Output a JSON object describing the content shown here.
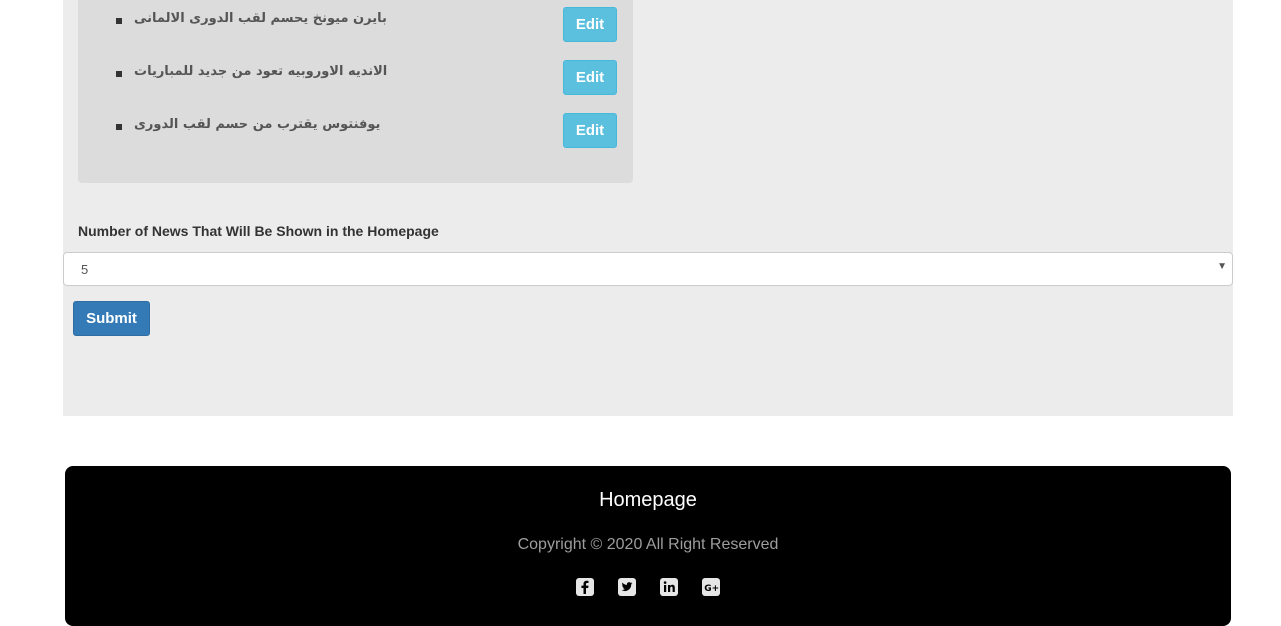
{
  "news": {
    "items": [
      {
        "title": "بايرن ميونخ يحسم لقب الدورى الالمانى",
        "edit_label": "Edit"
      },
      {
        "title": "الانديه الاوروبيه تعود من جديد للمباريات",
        "edit_label": "Edit"
      },
      {
        "title": "يوفنتوس يقترب من حسم لقب الدورى",
        "edit_label": "Edit"
      }
    ]
  },
  "settings": {
    "label": "Number of News That Will Be Shown in the Homepage",
    "selected_value": "5",
    "submit_label": "Submit"
  },
  "footer": {
    "title": "Homepage",
    "copyright": "Copyright © 2020 All Right Reserved",
    "social_icons": [
      "facebook-icon",
      "twitter-icon",
      "linkedin-icon",
      "google-plus-icon"
    ]
  },
  "colors": {
    "info_button": "#5bc0de",
    "primary_button": "#337ab7",
    "footer_bg": "#000000",
    "panel_bg": "#ececec"
  }
}
